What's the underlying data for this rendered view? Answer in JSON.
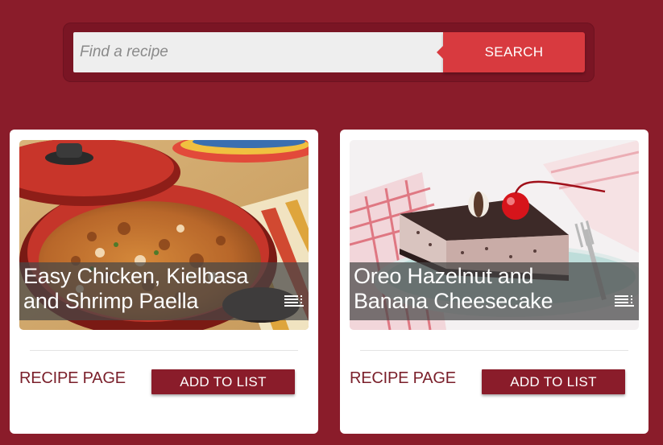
{
  "search": {
    "placeholder": "Find a recipe",
    "button_label": "SEARCH"
  },
  "recipes": [
    {
      "title": "Easy Chicken, Kielbasa and Shrimp Paella",
      "image": "paella-photo",
      "recipe_link_label": "RECIPE PAGE",
      "add_label": "ADD TO LIST"
    },
    {
      "title": "Oreo Hazelnut and Banana Cheesecake",
      "image": "cheesecake-photo",
      "recipe_link_label": "RECIPE PAGE",
      "add_label": "ADD TO LIST"
    }
  ],
  "colors": {
    "background": "#8a1c2a",
    "search_button": "#d83a3f",
    "add_button": "#8a1c2a",
    "link_text": "#7a1f2a"
  }
}
